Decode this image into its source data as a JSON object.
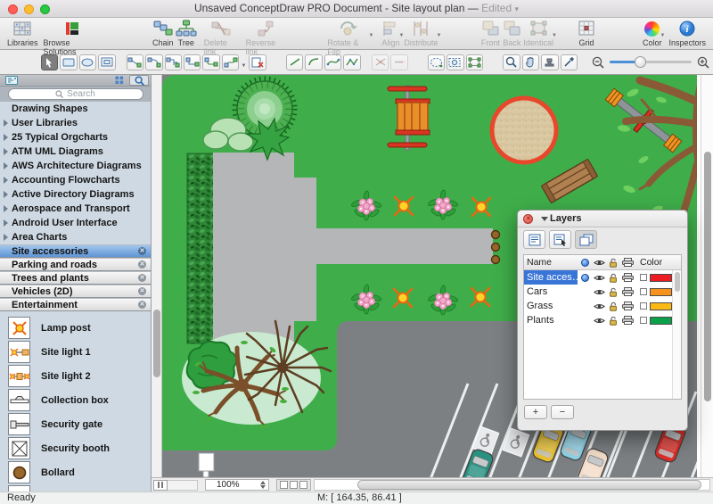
{
  "window": {
    "title": "Unsaved ConceptDraw PRO Document - Site layout plan —",
    "edited": "Edited"
  },
  "toolbar": {
    "items": [
      {
        "label": "Libraries",
        "icon": "libraries-icon",
        "enabled": true
      },
      {
        "label": "Browse Solutions",
        "icon": "browse-solutions-icon",
        "enabled": true
      },
      {
        "label": "Chain",
        "icon": "chain-icon",
        "enabled": true
      },
      {
        "label": "Tree",
        "icon": "tree-icon",
        "enabled": true
      },
      {
        "label": "Delete link",
        "icon": "delete-link-icon",
        "enabled": false
      },
      {
        "label": "Reverse link",
        "icon": "reverse-link-icon",
        "enabled": false
      },
      {
        "label": "Rotate & Flip",
        "icon": "rotate-flip-icon",
        "enabled": false
      },
      {
        "label": "Align",
        "icon": "align-icon",
        "enabled": false
      },
      {
        "label": "Distribute",
        "icon": "distribute-icon",
        "enabled": false
      },
      {
        "label": "Front",
        "icon": "front-icon",
        "enabled": false
      },
      {
        "label": "Back",
        "icon": "back-icon",
        "enabled": false
      },
      {
        "label": "Identical",
        "icon": "identical-icon",
        "enabled": false
      },
      {
        "label": "Grid",
        "icon": "grid-icon",
        "enabled": true
      },
      {
        "label": "Color",
        "icon": "color-icon",
        "enabled": true
      },
      {
        "label": "Inspectors",
        "icon": "inspectors-icon",
        "enabled": true
      }
    ]
  },
  "toolbar2": {
    "tools": [
      "select-tool",
      "rectangle-tool",
      "ellipse-tool",
      "frame-tool",
      "connector-direct",
      "connector-arc",
      "connector-smart",
      "connector-orthogonal",
      "connector-rounded",
      "connector-spline",
      "connector-menu",
      "delete-connector",
      "line-tool",
      "arc-tool",
      "bezier-tool",
      "polyline-tool",
      "trim-tool",
      "extend-tool",
      "path-select-tool",
      "zoom-area-tool",
      "group-select-tool",
      "zoom-tool",
      "pan-tool",
      "stamp-tool",
      "eyedropper-tool"
    ],
    "zoom_out": "−",
    "zoom_in": "+"
  },
  "sidebar": {
    "search_placeholder": "Search",
    "libraries": [
      {
        "label": "Drawing Shapes"
      },
      {
        "label": "User Libraries"
      },
      {
        "label": "25 Typical Orgcharts"
      },
      {
        "label": "ATM UML Diagrams"
      },
      {
        "label": "AWS Architecture Diagrams"
      },
      {
        "label": "Accounting Flowcharts"
      },
      {
        "label": "Active Directory Diagrams"
      },
      {
        "label": "Aerospace and Transport"
      },
      {
        "label": "Android User Interface"
      },
      {
        "label": "Area Charts"
      }
    ],
    "open_libraries": [
      {
        "label": "Site accessories"
      },
      {
        "label": "Parking and roads"
      },
      {
        "label": "Trees and plants"
      },
      {
        "label": "Vehicles (2D)"
      },
      {
        "label": "Entertainment"
      }
    ],
    "shapes": [
      {
        "label": "Lamp post",
        "icon": "lamp-post-icon"
      },
      {
        "label": "Site light 1",
        "icon": "site-light-1-icon"
      },
      {
        "label": "Site light 2",
        "icon": "site-light-2-icon"
      },
      {
        "label": "Collection box",
        "icon": "collection-box-icon"
      },
      {
        "label": "Security gate",
        "icon": "security-gate-icon"
      },
      {
        "label": "Security booth",
        "icon": "security-booth-icon"
      },
      {
        "label": "Bollard",
        "icon": "bollard-icon"
      }
    ]
  },
  "layers_panel": {
    "title": "Layers",
    "name_column": "Name",
    "color_column": "Color",
    "rows": [
      {
        "name": "Site acces…",
        "color": "#ed1c24",
        "selected": true,
        "active": true
      },
      {
        "name": "Cars",
        "color": "#f6921e"
      },
      {
        "name": "Grass",
        "color": "#fbb917"
      },
      {
        "name": "Plants",
        "color": "#0ba04a"
      }
    ],
    "add_button": "+",
    "remove_button": "−"
  },
  "bottom_bar": {
    "zoom_value": "100%"
  },
  "statusbar": {
    "ready": "Ready",
    "coordinates": "M: [ 164.35, 86.41 ]"
  },
  "canvas_colors": {
    "lawn": "#3fae4a",
    "road": "#7d8083",
    "pavement": "#b5b6b7",
    "hedge": "#2e8636",
    "sand": "#d8c7a0",
    "sandbox_ring": "#e8472b"
  }
}
